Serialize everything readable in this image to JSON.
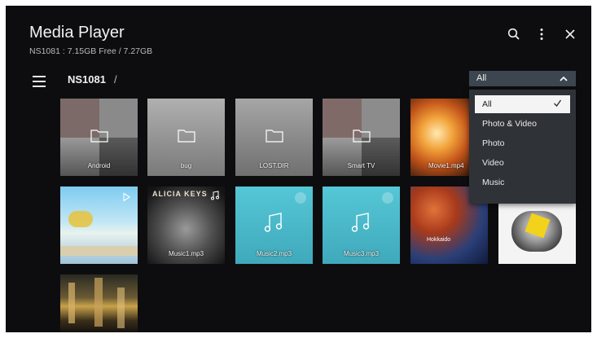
{
  "header": {
    "title": "Media Player",
    "storage": "NS1081 : 7.15GB Free / 7.27GB"
  },
  "breadcrumb": {
    "device": "NS1081",
    "separator": "/"
  },
  "filter": {
    "selected": "All",
    "options": [
      "All",
      "Photo & Video",
      "Photo",
      "Video",
      "Music"
    ]
  },
  "tiles": [
    {
      "kind": "folder",
      "label": "Android"
    },
    {
      "kind": "folder",
      "label": "bug"
    },
    {
      "kind": "folder",
      "label": "LOST.DIR"
    },
    {
      "kind": "folder",
      "label": "Smart TV"
    },
    {
      "kind": "video",
      "label": "Movie1.mp4"
    },
    {
      "kind": "photo",
      "label": ""
    },
    {
      "kind": "photo",
      "label": ""
    },
    {
      "kind": "music",
      "label": "Music1.mp3",
      "album_text": "ALICIA KEYS"
    },
    {
      "kind": "music",
      "label": "Music2.mp3"
    },
    {
      "kind": "music",
      "label": "Music3.mp3"
    },
    {
      "kind": "photo",
      "label": "",
      "watermark": "Hokkaido"
    },
    {
      "kind": "photo",
      "label": ""
    },
    {
      "kind": "photo",
      "label": ""
    }
  ],
  "colors": {
    "background": "#0d0d0f",
    "filter_bg": "#3d4650",
    "dropdown_bg": "#2f3338",
    "music_tile": "#4fc0cf"
  }
}
